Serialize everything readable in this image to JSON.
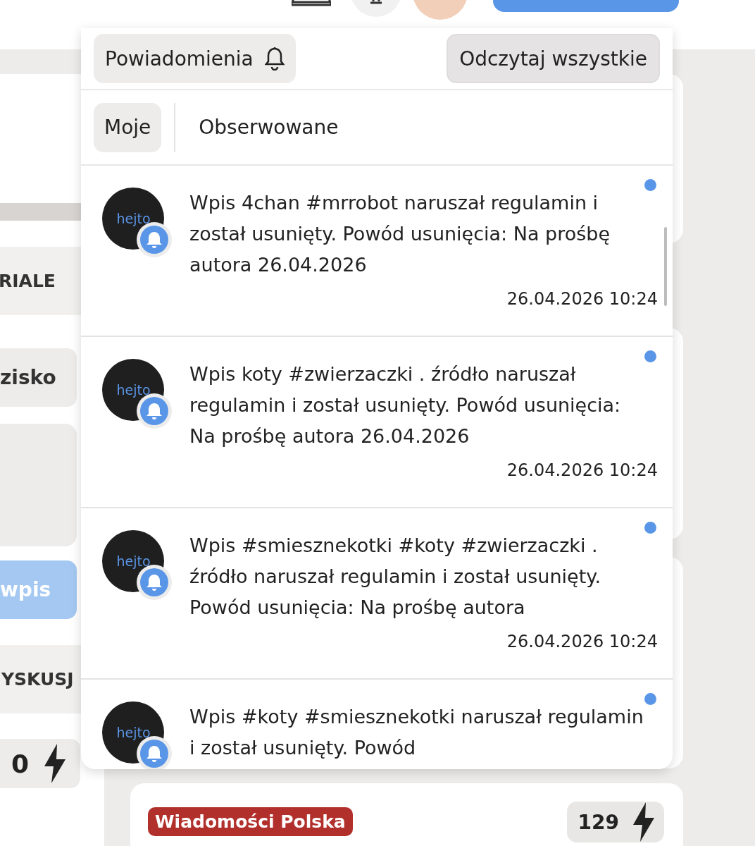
{
  "left_column": {
    "section_1": "RIALE",
    "button_1": "zisko",
    "button_2": "wpis",
    "section_2": "YSKUSJ",
    "count": "0"
  },
  "notifications_panel": {
    "title": "Powiadomienia",
    "mark_all_read": "Odczytaj wszystkie",
    "tabs": [
      {
        "label": "Moje",
        "selected": true
      },
      {
        "label": "Obserwowane",
        "selected": false
      }
    ],
    "items": [
      {
        "avatar": "hejto",
        "text": "Wpis 4chan #mrrobot naruszał regulamin i został usunięty. Powód usunięcia: Na prośbę autora 26.04.2026",
        "time": "26.04.2026 10:24",
        "unread": true
      },
      {
        "avatar": "hejto",
        "text": "Wpis koty #zwierzaczki . źródło naruszał regulamin i został usunięty. Powód usunięcia: Na prośbę autora 26.04.2026",
        "time": "26.04.2026 10:24",
        "unread": true
      },
      {
        "avatar": "hejto",
        "text": "Wpis #smiesznekotki #koty #zwierzaczki . źródło naruszał regulamin i został usunięty. Powód usunięcia: Na prośbę autora",
        "time": "26.04.2026 10:24",
        "unread": true
      },
      {
        "avatar": "hejto",
        "text": "Wpis #koty #smiesznekotki naruszał regulamin i został usunięty. Powód",
        "unread": true
      }
    ]
  },
  "post_card": {
    "community_tag": "Wiadomości Polska",
    "score": "129"
  }
}
